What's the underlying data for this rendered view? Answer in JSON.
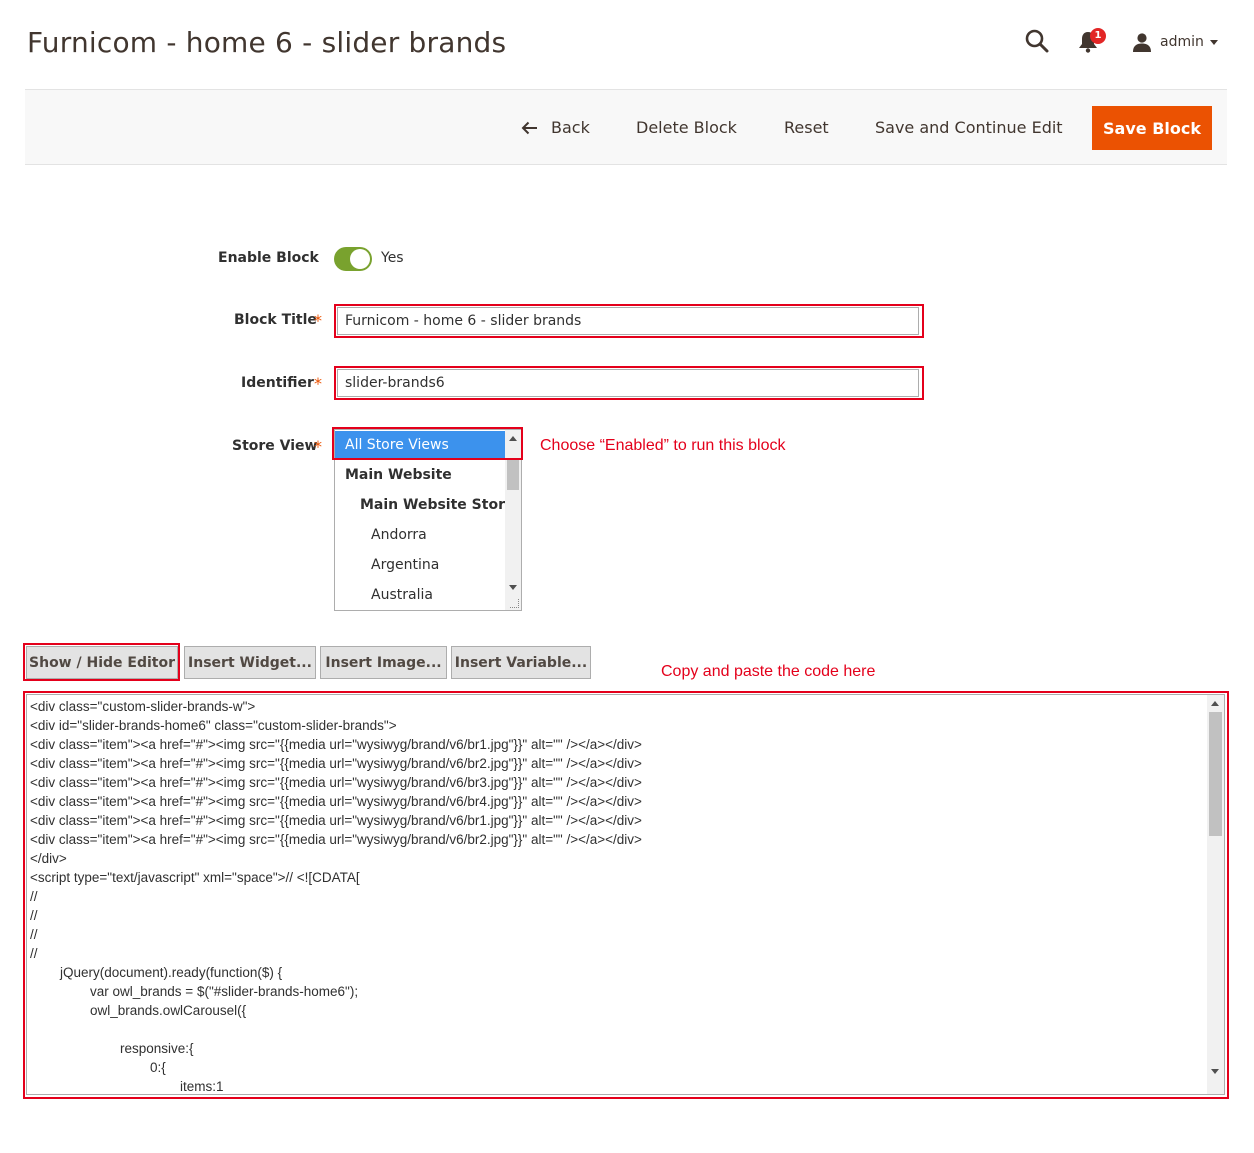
{
  "page": {
    "title": "Furnicom - home 6 - slider brands"
  },
  "header": {
    "notifications_count": "1",
    "user_name": "admin"
  },
  "actions": {
    "back_label": "Back",
    "delete_label": "Delete Block",
    "reset_label": "Reset",
    "save_continue_label": "Save and Continue Edit",
    "save_label": "Save Block"
  },
  "form": {
    "enable_label": "Enable Block",
    "enable_value": "Yes",
    "title_label": "Block Title",
    "title_value": "Furnicom - home 6 - slider brands",
    "identifier_label": "Identifier",
    "identifier_value": "slider-brands6",
    "store_view_label": "Store View",
    "required_mark": "*",
    "store_view_options": [
      "All Store Views",
      "Main Website",
      "Main Website Store",
      "Andorra",
      "Argentina",
      "Australia"
    ]
  },
  "annotations": {
    "store_view_note": "Choose “Enabled” to run this block",
    "code_note": "Copy and paste the code here"
  },
  "editor": {
    "show_hide_label": "Show / Hide Editor",
    "insert_widget_label": "Insert Widget...",
    "insert_image_label": "Insert Image...",
    "insert_variable_label": "Insert Variable...",
    "content": "<div class=\"custom-slider-brands-w\">\n<div id=\"slider-brands-home6\" class=\"custom-slider-brands\">\n<div class=\"item\"><a href=\"#\"><img src=\"{{media url=\"wysiwyg/brand/v6/br1.jpg\"}}\" alt=\"\" /></a></div>\n<div class=\"item\"><a href=\"#\"><img src=\"{{media url=\"wysiwyg/brand/v6/br2.jpg\"}}\" alt=\"\" /></a></div>\n<div class=\"item\"><a href=\"#\"><img src=\"{{media url=\"wysiwyg/brand/v6/br3.jpg\"}}\" alt=\"\" /></a></div>\n<div class=\"item\"><a href=\"#\"><img src=\"{{media url=\"wysiwyg/brand/v6/br4.jpg\"}}\" alt=\"\" /></a></div>\n<div class=\"item\"><a href=\"#\"><img src=\"{{media url=\"wysiwyg/brand/v6/br1.jpg\"}}\" alt=\"\" /></a></div>\n<div class=\"item\"><a href=\"#\"><img src=\"{{media url=\"wysiwyg/brand/v6/br2.jpg\"}}\" alt=\"\" /></a></div>\n</div>\n<script type=\"text/javascript\" xml=\"space\">// <![CDATA[\n//\n//\n//\n//\n        jQuery(document).ready(function($) {\n                var owl_brands = $(\"#slider-brands-home6\");\n                owl_brands.owlCarousel({\n\n                        responsive:{\n                                0:{\n                                        items:1"
  },
  "colors": {
    "accent": "#eb5202",
    "toggle_on": "#79a22e",
    "selection": "#3c92ed",
    "annotation": "#e4001b"
  }
}
